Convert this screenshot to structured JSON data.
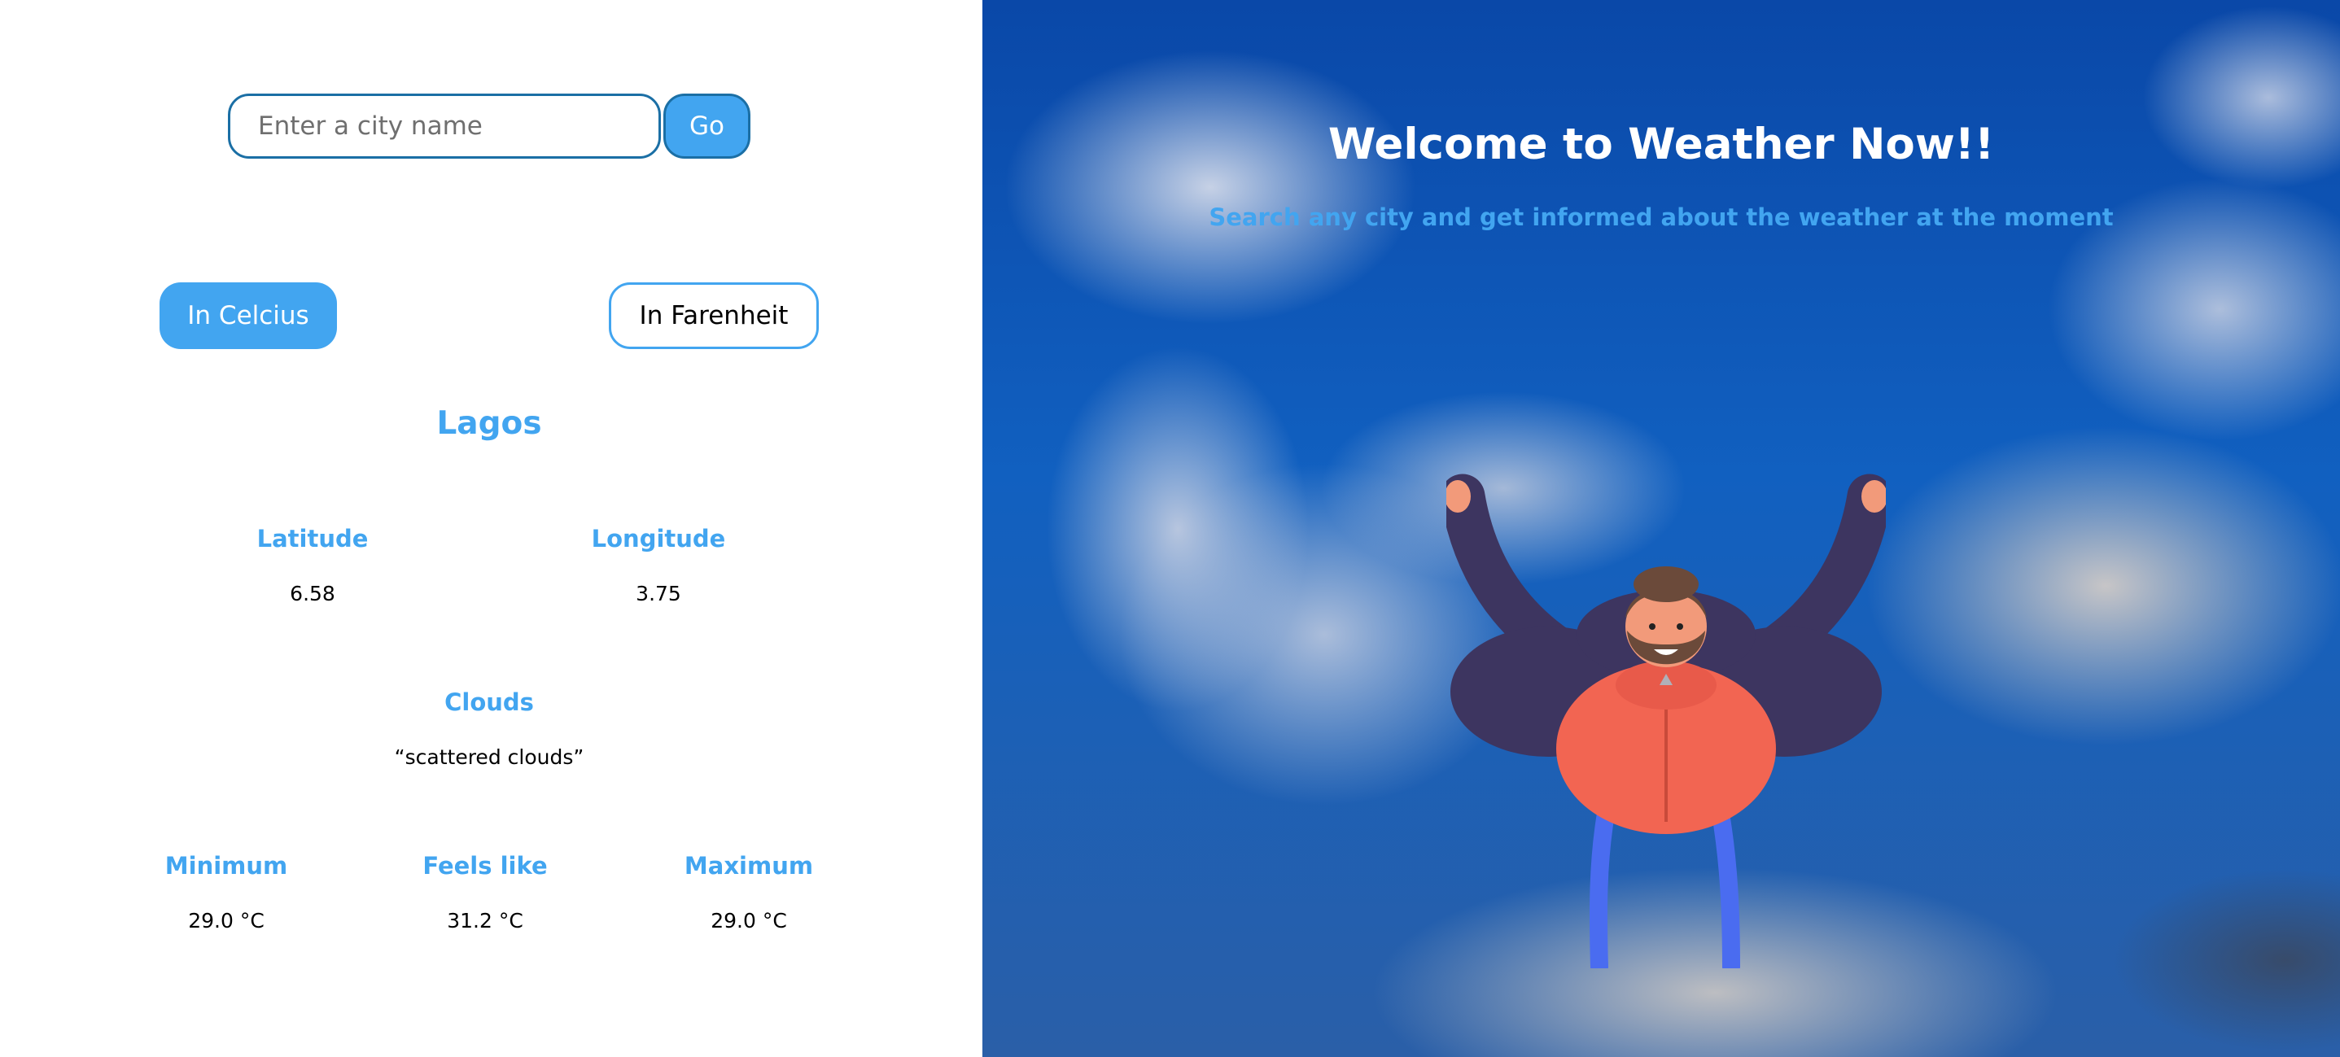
{
  "search": {
    "placeholder": "Enter a city name",
    "button_label": "Go"
  },
  "units": {
    "celsius_label": "In Celcius",
    "fahrenheit_label": "In Farenheit",
    "selected": "celsius"
  },
  "weather": {
    "city": "Lagos",
    "latitude_label": "Latitude",
    "latitude": "6.58",
    "longitude_label": "Longitude",
    "longitude": "3.75",
    "clouds_label": "Clouds",
    "clouds": "“scattered clouds”",
    "minimum_label": "Minimum",
    "minimum": "29.0 °C",
    "feels_like_label": "Feels like",
    "feels_like": "31.2 °C",
    "maximum_label": "Maximum",
    "maximum": "29.0 °C"
  },
  "hero": {
    "title": "Welcome to Weather Now!!",
    "subtitle": "Search any city and get informed about the weather at the moment"
  },
  "colors": {
    "accent": "#42a5f0",
    "border": "#1b6fa5",
    "sky": "#0a48a8"
  }
}
